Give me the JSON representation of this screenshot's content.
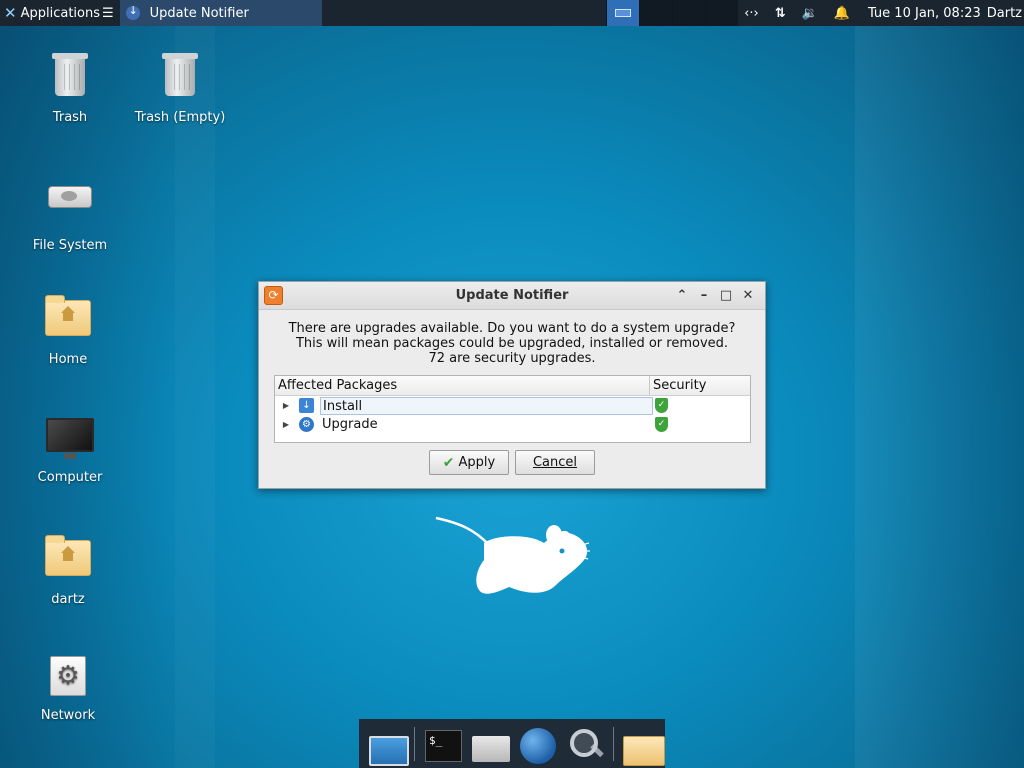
{
  "top_panel": {
    "applications_label": "Applications",
    "task_label": "Update Notifier",
    "clock": "Tue 10 Jan, 08:23",
    "user": "Dartz",
    "tray_icons": [
      "network-icon",
      "transfer-icon",
      "volume-icon",
      "notification-bell-icon"
    ]
  },
  "desktop": {
    "icons": [
      {
        "label": "Trash",
        "icon": "trash-icon"
      },
      {
        "label": "Trash (Empty)",
        "icon": "trash-icon"
      },
      {
        "label": "File System",
        "icon": "drive-icon"
      },
      {
        "label": "Home",
        "icon": "home-folder-icon"
      },
      {
        "label": "Computer",
        "icon": "monitor-icon"
      },
      {
        "label": "dartz",
        "icon": "home-folder-icon"
      },
      {
        "label": "Network",
        "icon": "gear-icon"
      }
    ]
  },
  "dialog": {
    "title": "Update Notifier",
    "message_lines": [
      "There are upgrades available. Do you want to do a system upgrade?",
      "This will mean packages could be upgraded, installed or removed.",
      "72 are security upgrades."
    ],
    "columns": [
      "Affected Packages",
      "Security"
    ],
    "rows": [
      {
        "label": "Install",
        "selected": true,
        "security": "shield-check-icon"
      },
      {
        "label": "Upgrade",
        "selected": false,
        "security": "shield-check-icon"
      }
    ],
    "apply_label": "Apply",
    "cancel_label": "Cancel"
  },
  "dock": {
    "items": [
      "show-desktop-icon",
      "terminal-icon",
      "home-icon",
      "web-browser-icon",
      "search-icon",
      "file-manager-icon"
    ]
  },
  "colors": {
    "panel_bg": "#1a2530",
    "active_workspace": "#2f6fb7",
    "dialog_bg": "#ececec",
    "accent_green": "#3ea33a"
  }
}
